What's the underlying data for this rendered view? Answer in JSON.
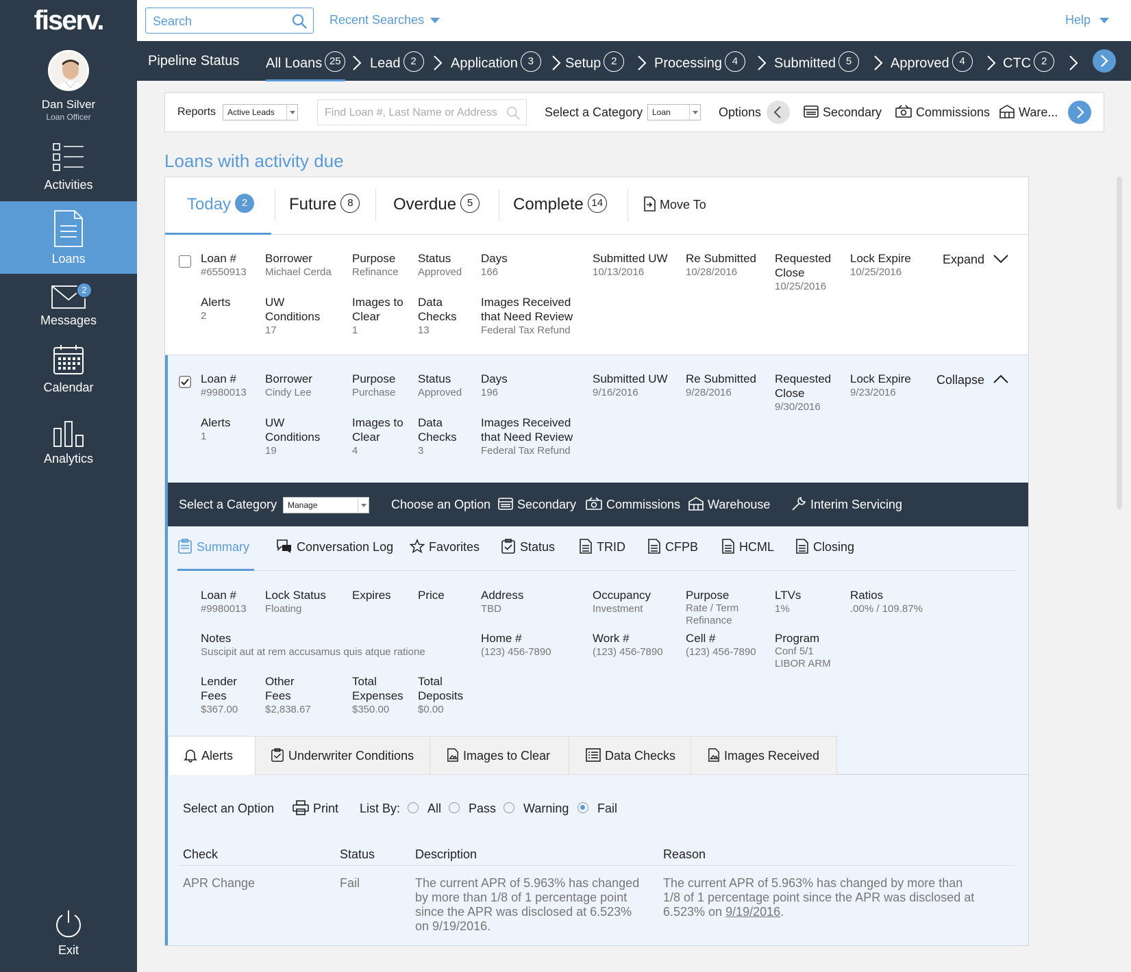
{
  "brand": {
    "logo": "fiserv."
  },
  "user": {
    "name": "Dan Silver",
    "role": "Loan Officer"
  },
  "nav": {
    "activities": "Activities",
    "loans": "Loans",
    "messages": "Messages",
    "messages_badge": "2",
    "calendar": "Calendar",
    "analytics": "Analytics",
    "exit": "Exit"
  },
  "topbar": {
    "search_placeholder": "Search",
    "recent": "Recent Searches",
    "help": "Help"
  },
  "pipeline": {
    "title": "Pipeline Status",
    "stages": [
      {
        "label": "All Loans",
        "count": "25"
      },
      {
        "label": "Lead",
        "count": "2"
      },
      {
        "label": "Application",
        "count": "3"
      },
      {
        "label": "Setup",
        "count": "2"
      },
      {
        "label": "Processing",
        "count": "4"
      },
      {
        "label": "Submitted",
        "count": "5"
      },
      {
        "label": "Approved",
        "count": "4"
      },
      {
        "label": "CTC",
        "count": "2"
      }
    ]
  },
  "filter": {
    "reports_label": "Reports",
    "reports_value": "Active Leads",
    "find_placeholder": "Find Loan #, Last Name or Address",
    "category_label": "Select a Category",
    "category_value": "Loan",
    "options_label": "Options",
    "secondary": "Secondary",
    "commissions": "Commissions",
    "warehouse": "Ware..."
  },
  "section_title": "Loans with activity due",
  "activity_tabs": [
    {
      "label": "Today",
      "count": "2"
    },
    {
      "label": "Future",
      "count": "8"
    },
    {
      "label": "Overdue",
      "count": "5"
    },
    {
      "label": "Complete",
      "count": "14"
    }
  ],
  "move_to": "Move To",
  "labels": {
    "loan": "Loan #",
    "borrower": "Borrower",
    "purpose": "Purpose",
    "status": "Status",
    "days": "Days",
    "submitted_uw": "Submitted UW",
    "re_submitted": "Re Submitted",
    "requested_close": "Requested Close",
    "lock_expire": "Lock Expire",
    "alerts": "Alerts",
    "uw_conditions": "UW Conditions",
    "images_to_clear": "Images to Clear",
    "data_checks": "Data Checks",
    "images_received": "Images Received that Need Review"
  },
  "loans": [
    {
      "loan": "#6550913",
      "borrower": "Michael Cerda",
      "purpose": "Refinance",
      "status": "Approved",
      "days": "166",
      "submitted_uw": "10/13/2016",
      "re_submitted": "10/28/2016",
      "requested_close": "10/25/2016",
      "lock_expire": "10/25/2016",
      "alerts": "2",
      "uw_conditions": "17",
      "images_to_clear": "1",
      "data_checks": "13",
      "images_received": "Federal Tax Refund",
      "action": "Expand"
    },
    {
      "loan": "#9980013",
      "borrower": "Cindy Lee",
      "purpose": "Purchase",
      "status": "Approved",
      "days": "196",
      "submitted_uw": "9/16/2016",
      "re_submitted": "9/28/2016",
      "requested_close": "9/30/2016",
      "lock_expire": "9/23/2016",
      "alerts": "1",
      "uw_conditions": "19",
      "images_to_clear": "4",
      "data_checks": "3",
      "images_received": "Federal Tax Refund",
      "action": "Collapse"
    }
  ],
  "manage_bar": {
    "category_label": "Select a Category",
    "category_value": "Manage",
    "choose": "Choose an Option",
    "secondary": "Secondary",
    "commissions": "Commissions",
    "warehouse": "Warehouse",
    "interim": "Interim Servicing"
  },
  "detail_tabs": [
    "Summary",
    "Conversation Log",
    "Favorites",
    "Status",
    "TRID",
    "CFPB",
    "HCML",
    "Closing"
  ],
  "summary": {
    "loan_label": "Loan #",
    "loan": "#9980013",
    "lock_status_label": "Lock Status",
    "lock_status": "Floating",
    "expires_label": "Expires",
    "price_label": "Price",
    "address_label": "Address",
    "address": "TBD",
    "occupancy_label": "Occupancy",
    "occupancy": "Investment",
    "purpose_label": "Purpose",
    "purpose": "Rate / Term Refinance",
    "ltvs_label": "LTVs",
    "ltvs": "1%",
    "ratios_label": "Ratios",
    "ratios": ".00% / 109.87%",
    "notes_label": "Notes",
    "notes": "Suscipit aut at rem accusamus quis atque ratione",
    "home_label": "Home #",
    "home": "(123) 456-7890",
    "work_label": "Work #",
    "work": "(123) 456-7890",
    "cell_label": "Cell #",
    "cell": "(123) 456-7890",
    "program_label": "Program",
    "program": "Conf 5/1 LIBOR ARM",
    "lender_fees_label": "Lender Fees",
    "lender_fees": "$367.00",
    "other_fees_label": "Other Fees",
    "other_fees": "$2,838.67",
    "total_expenses_label": "Total Expenses",
    "total_expenses": "$350.00",
    "total_deposits_label": "Total Deposits",
    "total_deposits": "$0.00"
  },
  "bottom_tabs": [
    "Alerts",
    "Underwriter Conditions",
    "Images to Clear",
    "Data Checks",
    "Images Received"
  ],
  "alerts_options": {
    "select": "Select an Option",
    "print": "Print",
    "list_by": "List By:",
    "all": "All",
    "pass": "Pass",
    "warning": "Warning",
    "fail": "Fail"
  },
  "alerts_table": {
    "headers": {
      "check": "Check",
      "status": "Status",
      "description": "Description",
      "reason": "Reason"
    },
    "rows": [
      {
        "check": "APR Change",
        "status": "Fail",
        "description": "The current APR of 5.963% has changed by more than 1/8 of 1 percentage point since the APR was disclosed at 6.523% on 9/19/2016.",
        "reason_text": "The current APR of 5.963% has changed by more than 1/8 of 1 percentage point since the APR was disclosed at 6.523% on",
        "reason_date": "9/19/2016",
        "reason_end": "."
      }
    ]
  }
}
